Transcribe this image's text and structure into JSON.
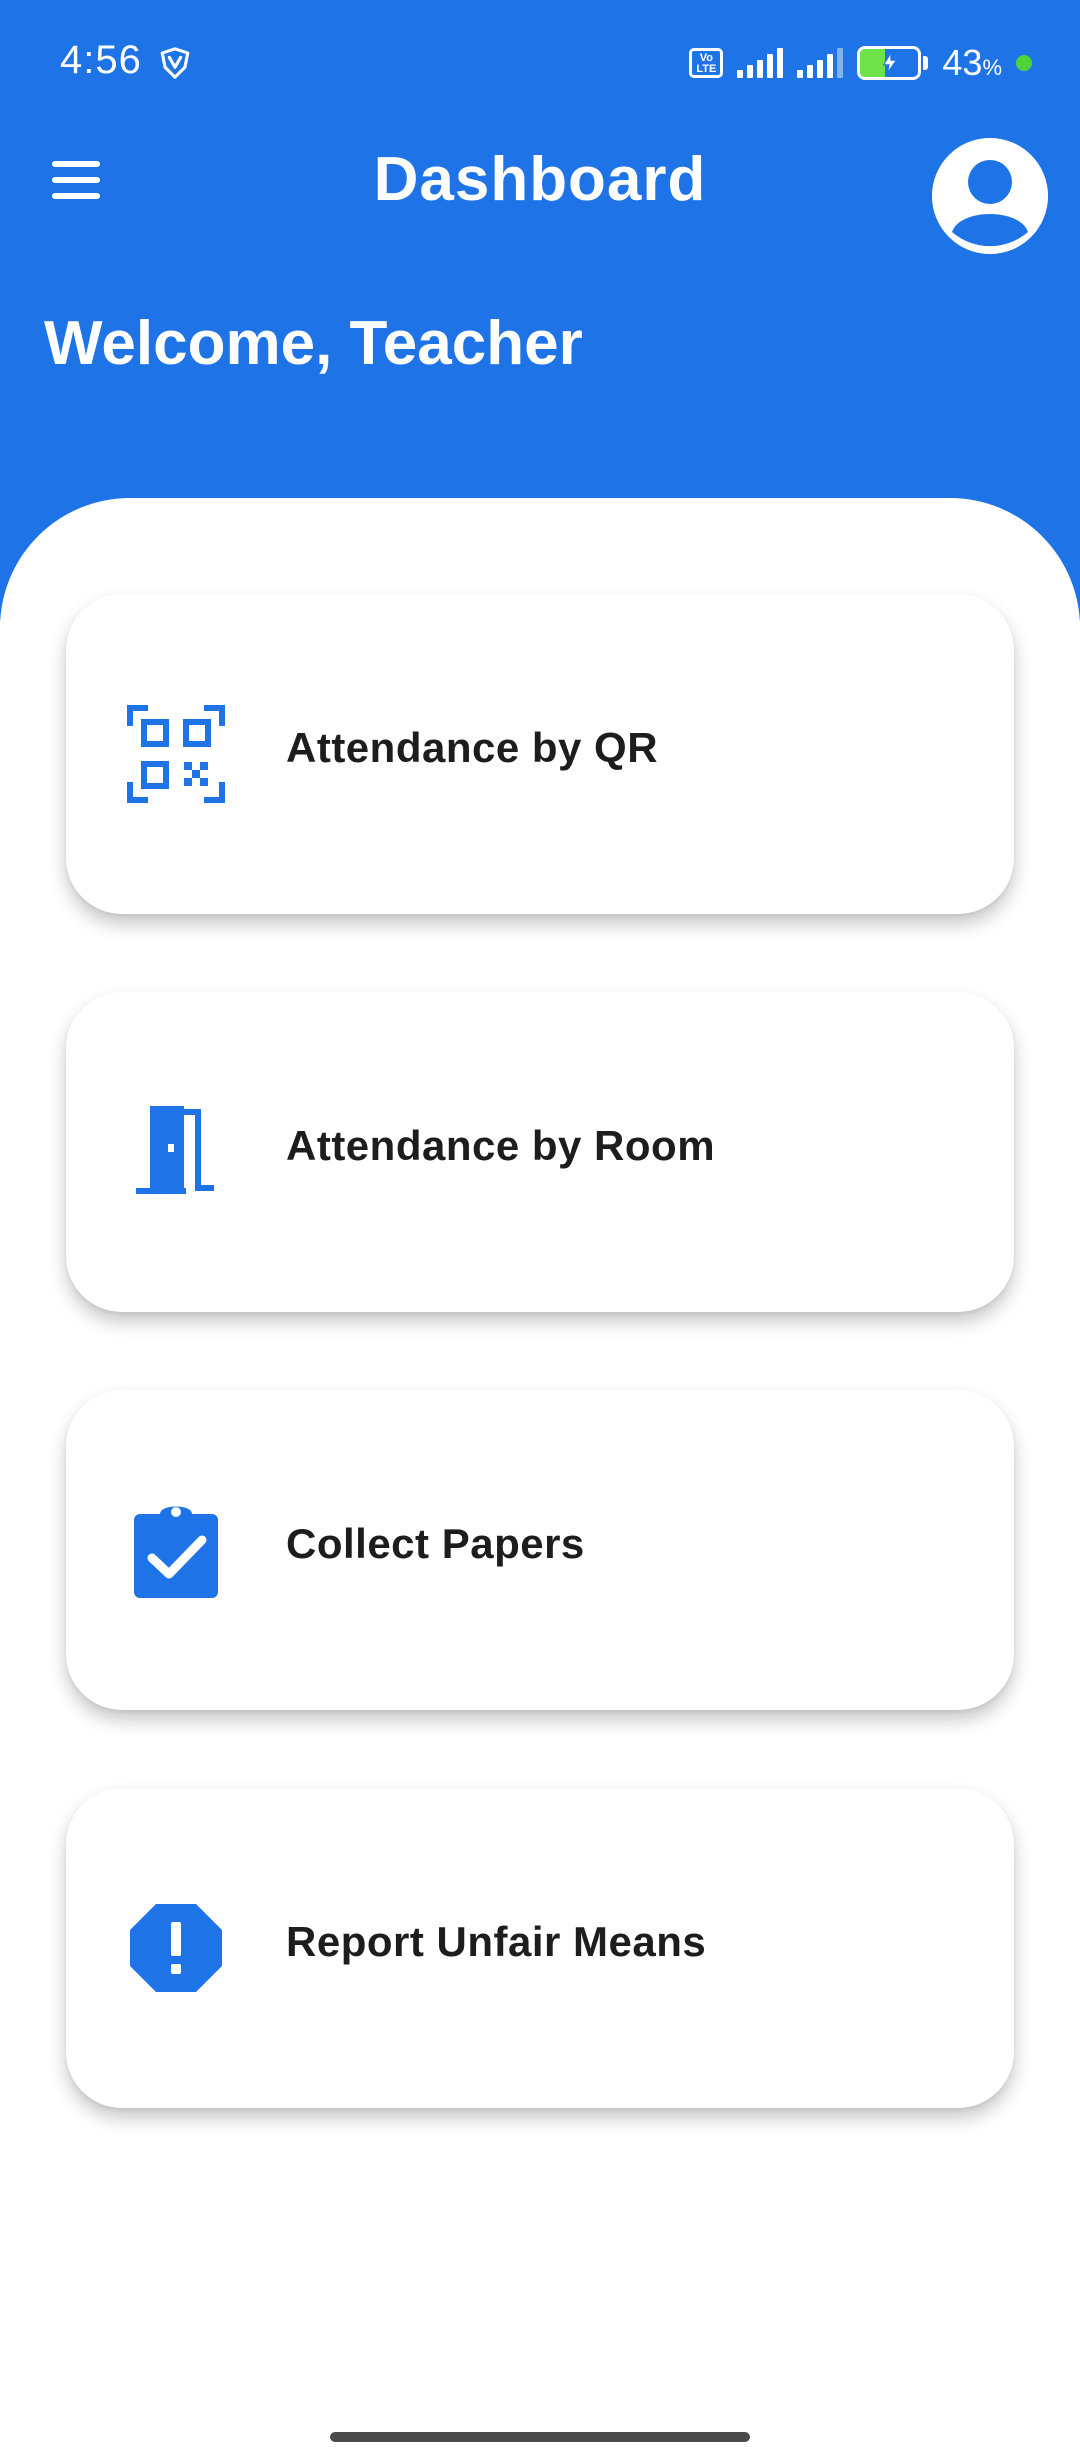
{
  "status_bar": {
    "time": "4:56",
    "volte_label": "Vo LTE",
    "battery_percent": "43",
    "battery_percent_unit": "%",
    "battery_level": 0.43,
    "battery_fill_color": "#6FE24A",
    "dot_color": "#4ED43A"
  },
  "app_bar": {
    "title": "Dashboard",
    "menu_icon": "hamburger-menu-icon",
    "profile_icon": "account-circle-icon"
  },
  "welcome_text": "Welcome, Teacher",
  "colors": {
    "primary": "#1E74E6",
    "card_text": "#1d1d1d",
    "background": "#ffffff"
  },
  "cards": [
    {
      "label": "Attendance by QR",
      "icon": "qr-code-scanner-icon"
    },
    {
      "label": "Attendance by Room",
      "icon": "door-icon"
    },
    {
      "label": "Collect Papers",
      "icon": "clipboard-check-icon"
    },
    {
      "label": "Report Unfair Means",
      "icon": "report-octagon-icon"
    }
  ]
}
